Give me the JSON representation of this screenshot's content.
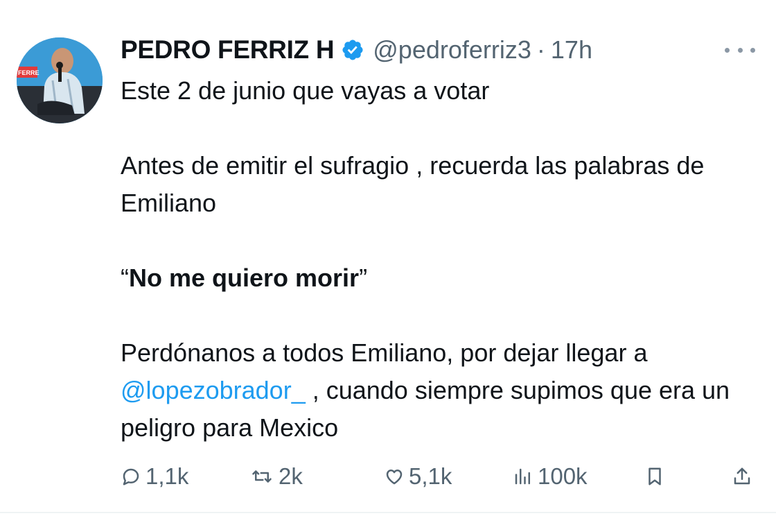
{
  "tweet": {
    "author_name": "PEDRO FERRIZ H",
    "handle": "@pedroferriz3",
    "separator": "·",
    "time": "17h",
    "line1": "Este 2 de junio que vayas a votar",
    "line2": "Antes de emitir el sufragio , recuerda las palabras de Emiliano",
    "quote_open": "“",
    "quote_text": "No me quiero morir",
    "quote_close": "”",
    "line4_start": "Perdónanos a todos Emiliano, por dejar llegar a",
    "mention": "@lopezobrador_",
    "line4_end": " , cuando siempre supimos que era un peligro para Mexico"
  },
  "actions": {
    "replies": "1,1k",
    "reposts": "2k",
    "likes": "5,1k",
    "views": "100k"
  },
  "avatar_banner_text": "FERRE",
  "icons": {
    "verified": "verified-badge-icon",
    "more": "more-options-icon",
    "reply": "reply-icon",
    "repost": "repost-icon",
    "like": "like-icon",
    "views": "views-icon",
    "bookmark": "bookmark-icon",
    "share": "share-icon"
  },
  "colors": {
    "text": "#0f1419",
    "secondary": "#536471",
    "accent": "#1d9bf0"
  }
}
